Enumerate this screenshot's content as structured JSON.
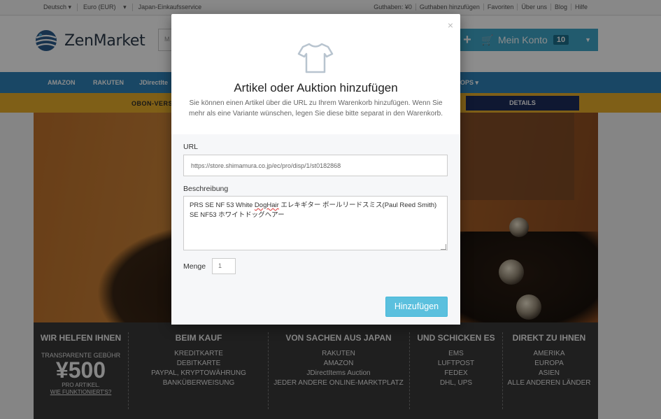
{
  "topbar": {
    "language": "Deutsch ▾",
    "currency": "Euro (EUR)",
    "currency_caret": "▾",
    "service": "Japan-Einkaufsservice",
    "links": [
      "Guthaben: ¥0",
      "Guthaben hinzufügen",
      "Favoriten",
      "Über uns",
      "Blog",
      "Hilfe"
    ]
  },
  "header": {
    "logo_text": "ZenMarket",
    "search_placeholder": "M",
    "account_label": "Mein Konto",
    "cart_count": "10"
  },
  "nav": {
    "items": [
      "AMAZON",
      "RAKUTEN",
      "JDirectIte",
      "OPS ▾"
    ]
  },
  "promo": {
    "text": "OBON-VERS",
    "details_label": "DETAILS"
  },
  "footer": {
    "help_title": "WIR HELFEN IHNEN",
    "fee_label": "TRANSPARENTE GEBÜHR",
    "price": "¥500",
    "price_note": "PRO ARTIKEL.",
    "price_link": "WIE FUNKTIONIERT'S?",
    "columns": [
      {
        "title": "BEIM KAUF",
        "items": [
          "KREDITKARTE",
          "DEBITKARTE",
          "PAYPAL, KRYPTOWÄHRUNG",
          "BANKÜBERWEISUNG"
        ]
      },
      {
        "title": "VON SACHEN AUS JAPAN",
        "items": [
          "RAKUTEN",
          "AMAZON",
          "JDirectItems Auction",
          "JEDER ANDERE ONLINE-MARKTPLATZ"
        ]
      },
      {
        "title": "UND SCHICKEN ES",
        "items": [
          "EMS",
          "LUFTPOST",
          "FEDEX",
          "DHL, UPS"
        ]
      },
      {
        "title": "DIREKT ZU IHNEN",
        "items": [
          "AMERIKA",
          "EUROPA",
          "ASIEN",
          "ALLE ANDEREN LÄNDER"
        ]
      }
    ]
  },
  "modal": {
    "close": "×",
    "title": "Artikel oder Auktion hinzufügen",
    "subtitle": "Sie können einen Artikel über die URL zu Ihrem Warenkorb hinzufügen. Wenn Sie mehr als eine Variante wünschen, legen Sie diese bitte separat in den Warenkorb.",
    "url_label": "URL",
    "url_value": "https://store.shimamura.co.jp/ec/pro/disp/1/st0182868",
    "desc_label": "Beschreibung",
    "desc_part1": "PRS SE NF 53 White ",
    "desc_squiggle": "DogHair",
    "desc_part2": " エレキギター ポールリードスミス(Paul Reed Smith) SE NF53 ホワイトドッグヘアー",
    "qty_label": "Menge",
    "qty_value": "1",
    "submit_label": "Hinzufügen"
  }
}
